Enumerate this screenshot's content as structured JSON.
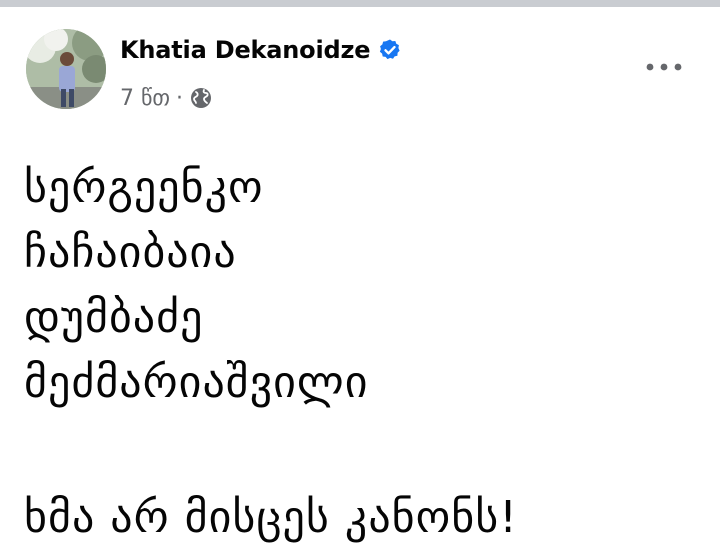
{
  "post": {
    "author": "Khatia Dekanoidze",
    "time": "7 წთ",
    "separator": "·",
    "lines": [
      "სერგეენკო",
      "ჩაჩაიბაია",
      "დუმბაძე",
      "მეძმარიაშვილი"
    ],
    "closing": "ხმა არ მისცეს კანონს!"
  },
  "icons": {
    "verified": "verified-badge-icon",
    "audience": "globe-icon",
    "more": "more-options-icon"
  },
  "colors": {
    "verified": "#1877f2",
    "meta_text": "#65676b",
    "text": "#050505"
  }
}
